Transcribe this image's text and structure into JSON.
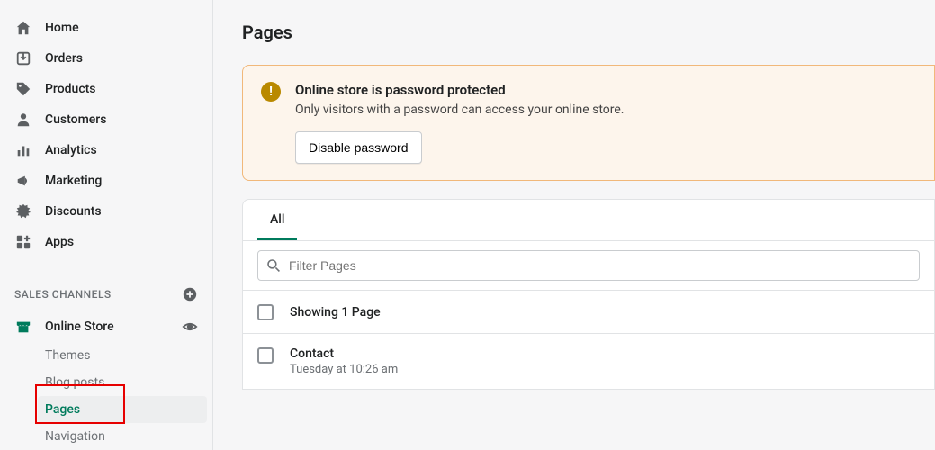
{
  "sidebar": {
    "items": [
      {
        "label": "Home"
      },
      {
        "label": "Orders"
      },
      {
        "label": "Products"
      },
      {
        "label": "Customers"
      },
      {
        "label": "Analytics"
      },
      {
        "label": "Marketing"
      },
      {
        "label": "Discounts"
      },
      {
        "label": "Apps"
      }
    ],
    "section_label": "SALES CHANNELS",
    "channel": {
      "label": "Online Store"
    },
    "subnav": [
      {
        "label": "Themes"
      },
      {
        "label": "Blog posts"
      },
      {
        "label": "Pages"
      },
      {
        "label": "Navigation"
      }
    ]
  },
  "page": {
    "title": "Pages"
  },
  "banner": {
    "title": "Online store is password protected",
    "text": "Only visitors with a password can access your online store.",
    "button": "Disable password"
  },
  "tabs": {
    "all": "All"
  },
  "filter": {
    "placeholder": "Filter Pages"
  },
  "list": {
    "header": "Showing 1 Page",
    "rows": [
      {
        "title": "Contact",
        "sub": "Tuesday at 10:26 am"
      }
    ]
  }
}
